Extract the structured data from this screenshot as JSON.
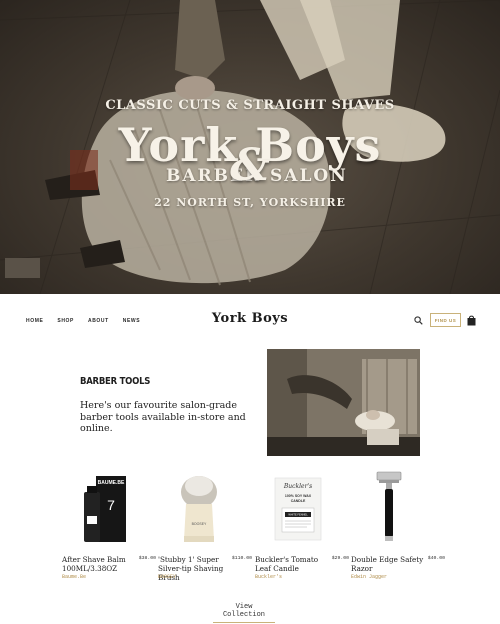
{
  "hero": {
    "tagline": "CLASSIC CUTS & STRAIGHT SHAVES",
    "brand": "York Boys",
    "word_left": "BARBER",
    "ampersand": "&",
    "word_right": "SALON",
    "address": "22 NORTH ST, YORKSHIRE"
  },
  "header": {
    "nav": [
      "HOME",
      "SHOP",
      "ABOUT",
      "NEWS"
    ],
    "logo": "York Boys",
    "find_us": "FIND US"
  },
  "intro": {
    "title": "BARBER TOOLS",
    "text": "Here's our favourite salon-grade barber tools available in-store and online."
  },
  "products": [
    {
      "name": "After Shave Balm 100ML/3.38OZ",
      "price": "$38.00",
      "vendor": "Baume.Be",
      "box_label": "BAUME.BE"
    },
    {
      "name": "'Stubby 1' Super Silver-tip Shaving Brush",
      "price": "$110.00",
      "vendor": "BOOSEY",
      "box_label": "BOOSEY"
    },
    {
      "name": "Buckler's Tomato Leaf Candle",
      "price": "$29.00",
      "vendor": "Buckler's",
      "box_label": "Buckler's",
      "box_sub": "100% SOY WAX",
      "box_sub2": "CANDLE",
      "box_tag": "WHITE FENNEL"
    },
    {
      "name": "Double Edge Safety Razor",
      "price": "$40.00",
      "vendor": "Edwin Jagger"
    }
  ],
  "view_collection": "View Collection",
  "colors": {
    "accent": "#b39552",
    "hero_dark": "#3f372e"
  }
}
